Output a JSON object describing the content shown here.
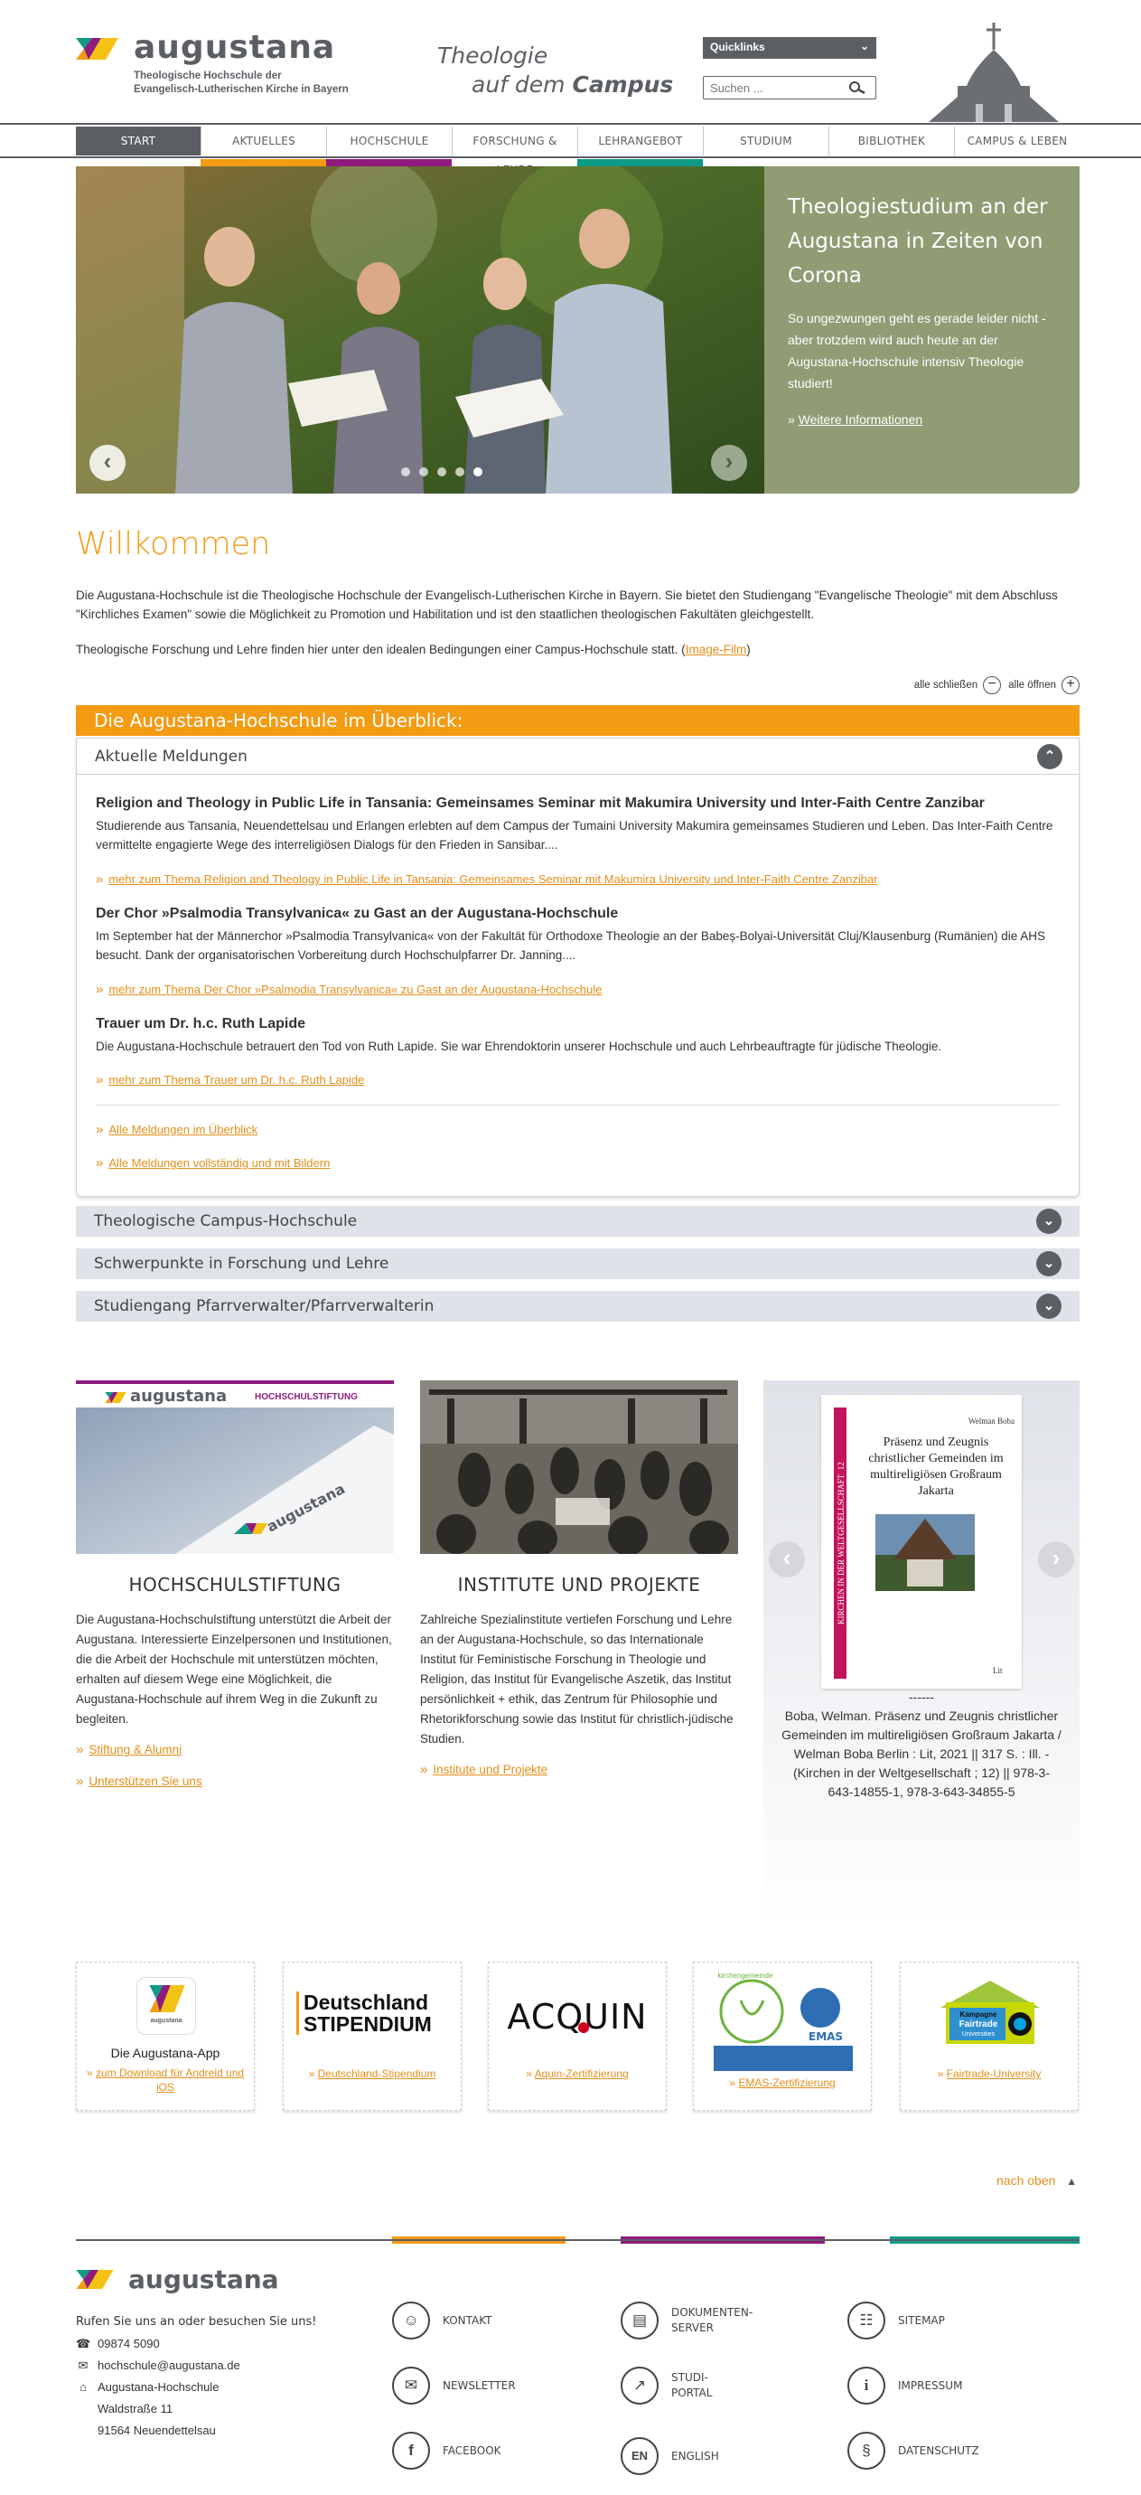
{
  "header": {
    "logo_text": "augustana",
    "logo_sub1": "Theologische Hochschule der",
    "logo_sub2": "Evangelisch-Lutherischen Kirche in Bayern",
    "tagline_l1": "Theologie",
    "tagline_l2a": "auf dem",
    "tagline_l2b": "Campus",
    "quicklinks": "Quicklinks",
    "search_placeholder": "Suchen ..."
  },
  "nav": [
    "START",
    "AKTUELLES",
    "HOCHSCHULE",
    "FORSCHUNG & LEHRE",
    "LEHRANGEBOT",
    "STUDIUM",
    "BIBLIOTHEK",
    "CAMPUS & LEBEN"
  ],
  "colors": {
    "orange": "#f39b13",
    "purple": "#8e1b7e",
    "teal": "#0e9a86",
    "gray": "#5b5f64"
  },
  "slider": {
    "title": "Theologiestudium an der Augustana in Zeiten von Corona",
    "text": "So ungezwungen geht es gerade leider nicht - aber trotzdem wird auch heute an der Augustana-Hochschule intensiv Theologie studiert!",
    "link": "Weitere Informationen"
  },
  "welcome": {
    "title": "Willkommen",
    "p1": "Die Augustana-Hochschule ist die Theologische Hochschule der Evangelisch-Lutherischen Kirche in Bayern. Sie bietet den Studiengang \"Evangelische Theologie\" mit dem Abschluss \"Kirchliches Examen\" sowie die Möglichkeit zu Promotion und Habilitation und ist den staatlichen theologischen Fakultäten gleichgestellt.",
    "p2_pre": "Theologische Forschung und Lehre finden hier unter den idealen Bedingungen einer Campus-Hochschule statt. (",
    "p2_link": "Image-Film",
    "p2_post": ")"
  },
  "toggles": {
    "close_all": "alle schließen",
    "open_all": "alle öffnen"
  },
  "overview": {
    "title": "Die Augustana-Hochschule im Überblick:",
    "open_section": "Aktuelle Meldungen",
    "news": [
      {
        "title": "Religion and Theology in Public Life in Tansania: Gemeinsames Seminar mit Makumira University und Inter-Faith Centre Zanzibar",
        "text": "Studierende aus Tansania, Neuendettelsau und Erlangen erlebten auf dem Campus der Tumaini University Makumira gemeinsames Studieren und Leben. Das Inter-Faith Centre vermittelte engagierte Wege des interreligiösen Dialogs für den Frieden in Sansibar....",
        "more": "mehr zum Thema Religion and Theology in Public Life in Tansania: Gemeinsames Seminar mit Makumira University und Inter-Faith Centre Zanzibar"
      },
      {
        "title": "Der Chor »Psalmodia Transylvanica« zu Gast an der Augustana-Hochschule",
        "text": "Im September hat der Männerchor »Psalmodia Transylvanica« von der Fakultät für Orthodoxe Theologie an der Babeș-Bolyai-Universität Cluj/Klausenburg (Rumänien) die AHS besucht. Dank der organisatorischen Vorbereitung durch Hochschulpfarrer Dr. Janning....",
        "more": "mehr zum Thema Der Chor »Psalmodia Transylvanica« zu Gast an der Augustana-Hochschule"
      },
      {
        "title": "Trauer um Dr. h.c. Ruth Lapide",
        "text": "Die Augustana-Hochschule betrauert den Tod von Ruth Lapide. Sie war Ehrendoktorin unserer Hochschule und auch Lehrbeauftragte für jüdische Theologie.",
        "more": "mehr zum Thema Trauer um Dr. h.c. Ruth Lapide"
      }
    ],
    "all_overview": "Alle Meldungen im Überblick",
    "all_full": "Alle Meldungen vollständig und mit Bildern",
    "closed_sections": [
      "Theologische Campus-Hochschule",
      "Schwerpunkte in Forschung und Lehre",
      "Studiengang Pfarrverwalter/Pfarrverwalterin"
    ]
  },
  "columns": {
    "stiftung": {
      "banner_logo": "augustana",
      "banner_label": "HOCHSCHULSTIFTUNG",
      "title": "HOCHSCHULSTIFTUNG",
      "text": "Die Augustana-Hochschulstiftung unterstützt die Arbeit der Augustana. Interessierte Einzelpersonen und Institutionen, die die Arbeit der Hochschule mit unterstützen möchten, erhalten auf diesem Wege eine Möglichkeit, die Augustana-Hochschule auf ihrem Weg in die Zukunft zu begleiten.",
      "link1": "Stiftung & Alumni",
      "link2": "Unterstützen Sie uns"
    },
    "institute": {
      "title": "INSTITUTE UND PROJEKTE",
      "text": "Zahlreiche Spezialinstitute vertiefen Forschung und Lehre an der Augustana-Hochschule, so das Internationale Institut für Feministische Forschung in Theologie und Religion, das Institut für Evangelische Aszetik, das Institut persönlichkeit + ethik, das Zentrum für Philosophie und Rhetorikforschung sowie das Institut für christlich-jüdische Studien.",
      "link": "Institute und Projekte"
    },
    "book": {
      "spine_text": "KIRCHEN IN DER WELTGESELLSCHAFT",
      "spine_number": "12",
      "author_on_cover": "Welman Boba",
      "cover_title": "Präsenz und Zeugnis christlicher Gemeinden im multireligiösen Großraum Jakarta",
      "publisher_on_cover": "Lit",
      "caption_dash": "------",
      "caption": "Boba, Welman. Präsenz und Zeugnis christlicher Gemeinden im multireligiösen Großraum Jakarta / Welman Boba Berlin : Lit, 2021 || 317 S. : Ill. - (Kirchen in der Weltgesellschaft ; 12) || 978-3-643-14855-1, 978-3-643-34855-5"
    }
  },
  "partners": [
    {
      "name": "Die Augustana-App",
      "icon_text": "augustana",
      "link": "zum Download für Andreid und iOS"
    },
    {
      "name_l1": "Deutschland",
      "name_l2": "STIPENDIUM",
      "link": "Deutschland-Stipendium"
    },
    {
      "name": "ACQUIN",
      "link": "Aquin-Zertifizierung"
    },
    {
      "name": "kirchengemeinde",
      "label": "EMAS",
      "link": "EMAS-Zertifizierung"
    },
    {
      "name_l1": "Kampagne",
      "name_l2": "Fairtrade",
      "name_l3": "Universities",
      "link": "Fairtrade-University"
    }
  ],
  "to_top": "nach oben",
  "footer": {
    "logo_text": "augustana",
    "intro": "Rufen Sie uns an oder besuchen Sie uns!",
    "phone": "09874 5090",
    "email": "hochschule@augustana.de",
    "addr1": "Augustana-Hochschule",
    "addr2": "Waldstraße 11",
    "addr3": "91564 Neuendettelsau",
    "links": {
      "kontakt": "KONTAKT",
      "dokumentenserver_1": "DOKUMENTEN-",
      "dokumentenserver_2": "SERVER",
      "sitemap": "SITEMAP",
      "newsletter": "NEWSLETTER",
      "studiportal_1": "STUDI-",
      "studiportal_2": "PORTAL",
      "impressum": "IMPRESSUM",
      "facebook": "FACEBOOK",
      "english": "ENGLISH",
      "english_icon": "EN",
      "datenschutz": "DATENSCHUTZ"
    }
  }
}
